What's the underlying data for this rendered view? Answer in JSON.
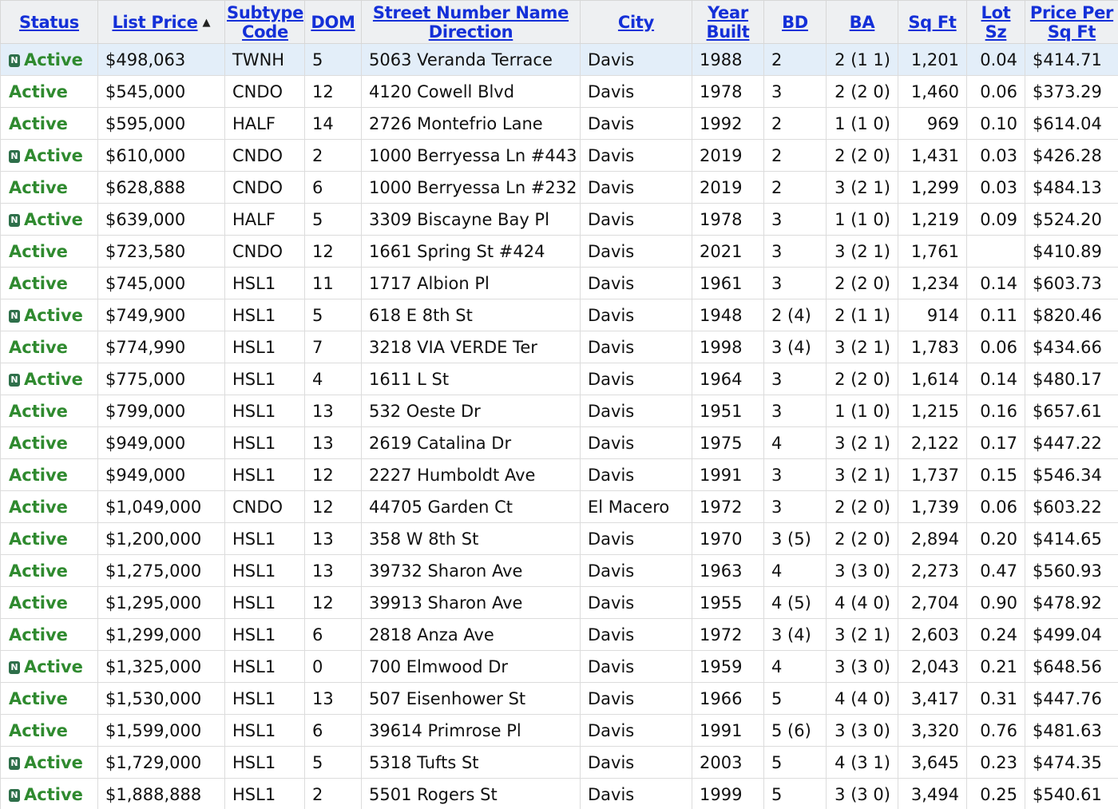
{
  "headers": {
    "status": "Status",
    "list_price": "List Price",
    "subtype_code": "Subtype Code",
    "dom": "DOM",
    "street": "Street Number Name Direction",
    "city": "City",
    "year_built": "Year Built",
    "bd": "BD",
    "ba": "BA",
    "sqft": "Sq Ft",
    "lot_sz": "Lot Sz",
    "price_per_sqft": "Price Per Sq Ft"
  },
  "sort": {
    "column": "list_price",
    "direction": "ascending"
  },
  "colors": {
    "header_link": "#1430d8",
    "status_active": "#2f8a2f",
    "new_badge": "#2e6f4a",
    "selected_row": "#e3eef9"
  },
  "badge_label": "N",
  "rows": [
    {
      "new": true,
      "status": "Active",
      "price": "$498,063",
      "subtype": "TWNH",
      "dom": "5",
      "street": "5063 Veranda Terrace",
      "city": "Davis",
      "year": "1988",
      "bd": "2",
      "ba": "2 (1 1)",
      "sqft": "1,201",
      "lot": "0.04",
      "pps": "$414.71",
      "selected": true
    },
    {
      "new": false,
      "status": "Active",
      "price": "$545,000",
      "subtype": "CNDO",
      "dom": "12",
      "street": "4120 Cowell Blvd",
      "city": "Davis",
      "year": "1978",
      "bd": "3",
      "ba": "2 (2 0)",
      "sqft": "1,460",
      "lot": "0.06",
      "pps": "$373.29"
    },
    {
      "new": false,
      "status": "Active",
      "price": "$595,000",
      "subtype": "HALF",
      "dom": "14",
      "street": "2726 Montefrio Lane",
      "city": "Davis",
      "year": "1992",
      "bd": "2",
      "ba": "1 (1 0)",
      "sqft": "969",
      "lot": "0.10",
      "pps": "$614.04"
    },
    {
      "new": true,
      "status": "Active",
      "price": "$610,000",
      "subtype": "CNDO",
      "dom": "2",
      "street": "1000 Berryessa Ln #443",
      "city": "Davis",
      "year": "2019",
      "bd": "2",
      "ba": "2 (2 0)",
      "sqft": "1,431",
      "lot": "0.03",
      "pps": "$426.28"
    },
    {
      "new": false,
      "status": "Active",
      "price": "$628,888",
      "subtype": "CNDO",
      "dom": "6",
      "street": "1000 Berryessa Ln #232",
      "city": "Davis",
      "year": "2019",
      "bd": "2",
      "ba": "3 (2 1)",
      "sqft": "1,299",
      "lot": "0.03",
      "pps": "$484.13"
    },
    {
      "new": true,
      "status": "Active",
      "price": "$639,000",
      "subtype": "HALF",
      "dom": "5",
      "street": "3309 Biscayne Bay Pl",
      "city": "Davis",
      "year": "1978",
      "bd": "3",
      "ba": "1 (1 0)",
      "sqft": "1,219",
      "lot": "0.09",
      "pps": "$524.20"
    },
    {
      "new": false,
      "status": "Active",
      "price": "$723,580",
      "subtype": "CNDO",
      "dom": "12",
      "street": "1661 Spring St #424",
      "city": "Davis",
      "year": "2021",
      "bd": "3",
      "ba": "3 (2 1)",
      "sqft": "1,761",
      "lot": "",
      "pps": "$410.89"
    },
    {
      "new": false,
      "status": "Active",
      "price": "$745,000",
      "subtype": "HSL1",
      "dom": "11",
      "street": "1717 Albion Pl",
      "city": "Davis",
      "year": "1961",
      "bd": "3",
      "ba": "2 (2 0)",
      "sqft": "1,234",
      "lot": "0.14",
      "pps": "$603.73"
    },
    {
      "new": true,
      "status": "Active",
      "price": "$749,900",
      "subtype": "HSL1",
      "dom": "5",
      "street": "618 E 8th St",
      "city": "Davis",
      "year": "1948",
      "bd": "2 (4)",
      "ba": "2 (1 1)",
      "sqft": "914",
      "lot": "0.11",
      "pps": "$820.46"
    },
    {
      "new": false,
      "status": "Active",
      "price": "$774,990",
      "subtype": "HSL1",
      "dom": "7",
      "street": "3218 VIA VERDE Ter",
      "city": "Davis",
      "year": "1998",
      "bd": "3 (4)",
      "ba": "3 (2 1)",
      "sqft": "1,783",
      "lot": "0.06",
      "pps": "$434.66"
    },
    {
      "new": true,
      "status": "Active",
      "price": "$775,000",
      "subtype": "HSL1",
      "dom": "4",
      "street": "1611 L St",
      "city": "Davis",
      "year": "1964",
      "bd": "3",
      "ba": "2 (2 0)",
      "sqft": "1,614",
      "lot": "0.14",
      "pps": "$480.17"
    },
    {
      "new": false,
      "status": "Active",
      "price": "$799,000",
      "subtype": "HSL1",
      "dom": "13",
      "street": "532 Oeste Dr",
      "city": "Davis",
      "year": "1951",
      "bd": "3",
      "ba": "1 (1 0)",
      "sqft": "1,215",
      "lot": "0.16",
      "pps": "$657.61"
    },
    {
      "new": false,
      "status": "Active",
      "price": "$949,000",
      "subtype": "HSL1",
      "dom": "13",
      "street": "2619 Catalina Dr",
      "city": "Davis",
      "year": "1975",
      "bd": "4",
      "ba": "3 (2 1)",
      "sqft": "2,122",
      "lot": "0.17",
      "pps": "$447.22"
    },
    {
      "new": false,
      "status": "Active",
      "price": "$949,000",
      "subtype": "HSL1",
      "dom": "12",
      "street": "2227 Humboldt Ave",
      "city": "Davis",
      "year": "1991",
      "bd": "3",
      "ba": "3 (2 1)",
      "sqft": "1,737",
      "lot": "0.15",
      "pps": "$546.34"
    },
    {
      "new": false,
      "status": "Active",
      "price": "$1,049,000",
      "subtype": "CNDO",
      "dom": "12",
      "street": "44705 Garden Ct",
      "city": "El Macero",
      "year": "1972",
      "bd": "3",
      "ba": "2 (2 0)",
      "sqft": "1,739",
      "lot": "0.06",
      "pps": "$603.22"
    },
    {
      "new": false,
      "status": "Active",
      "price": "$1,200,000",
      "subtype": "HSL1",
      "dom": "13",
      "street": "358 W 8th St",
      "city": "Davis",
      "year": "1970",
      "bd": "3 (5)",
      "ba": "2 (2 0)",
      "sqft": "2,894",
      "lot": "0.20",
      "pps": "$414.65"
    },
    {
      "new": false,
      "status": "Active",
      "price": "$1,275,000",
      "subtype": "HSL1",
      "dom": "13",
      "street": "39732 Sharon Ave",
      "city": "Davis",
      "year": "1963",
      "bd": "4",
      "ba": "3 (3 0)",
      "sqft": "2,273",
      "lot": "0.47",
      "pps": "$560.93"
    },
    {
      "new": false,
      "status": "Active",
      "price": "$1,295,000",
      "subtype": "HSL1",
      "dom": "12",
      "street": "39913 Sharon Ave",
      "city": "Davis",
      "year": "1955",
      "bd": "4 (5)",
      "ba": "4 (4 0)",
      "sqft": "2,704",
      "lot": "0.90",
      "pps": "$478.92"
    },
    {
      "new": false,
      "status": "Active",
      "price": "$1,299,000",
      "subtype": "HSL1",
      "dom": "6",
      "street": "2818 Anza Ave",
      "city": "Davis",
      "year": "1972",
      "bd": "3 (4)",
      "ba": "3 (2 1)",
      "sqft": "2,603",
      "lot": "0.24",
      "pps": "$499.04"
    },
    {
      "new": true,
      "status": "Active",
      "price": "$1,325,000",
      "subtype": "HSL1",
      "dom": "0",
      "street": "700 Elmwood Dr",
      "city": "Davis",
      "year": "1959",
      "bd": "4",
      "ba": "3 (3 0)",
      "sqft": "2,043",
      "lot": "0.21",
      "pps": "$648.56"
    },
    {
      "new": false,
      "status": "Active",
      "price": "$1,530,000",
      "subtype": "HSL1",
      "dom": "13",
      "street": "507 Eisenhower St",
      "city": "Davis",
      "year": "1966",
      "bd": "5",
      "ba": "4 (4 0)",
      "sqft": "3,417",
      "lot": "0.31",
      "pps": "$447.76"
    },
    {
      "new": false,
      "status": "Active",
      "price": "$1,599,000",
      "subtype": "HSL1",
      "dom": "6",
      "street": "39614 Primrose Pl",
      "city": "Davis",
      "year": "1991",
      "bd": "5 (6)",
      "ba": "3 (3 0)",
      "sqft": "3,320",
      "lot": "0.76",
      "pps": "$481.63"
    },
    {
      "new": true,
      "status": "Active",
      "price": "$1,729,000",
      "subtype": "HSL1",
      "dom": "5",
      "street": "5318 Tufts St",
      "city": "Davis",
      "year": "2003",
      "bd": "5",
      "ba": "4 (3 1)",
      "sqft": "3,645",
      "lot": "0.23",
      "pps": "$474.35"
    },
    {
      "new": true,
      "status": "Active",
      "price": "$1,888,888",
      "subtype": "HSL1",
      "dom": "2",
      "street": "5501 Rogers St",
      "city": "Davis",
      "year": "1999",
      "bd": "5",
      "ba": "3 (3 0)",
      "sqft": "3,494",
      "lot": "0.25",
      "pps": "$540.61"
    }
  ]
}
